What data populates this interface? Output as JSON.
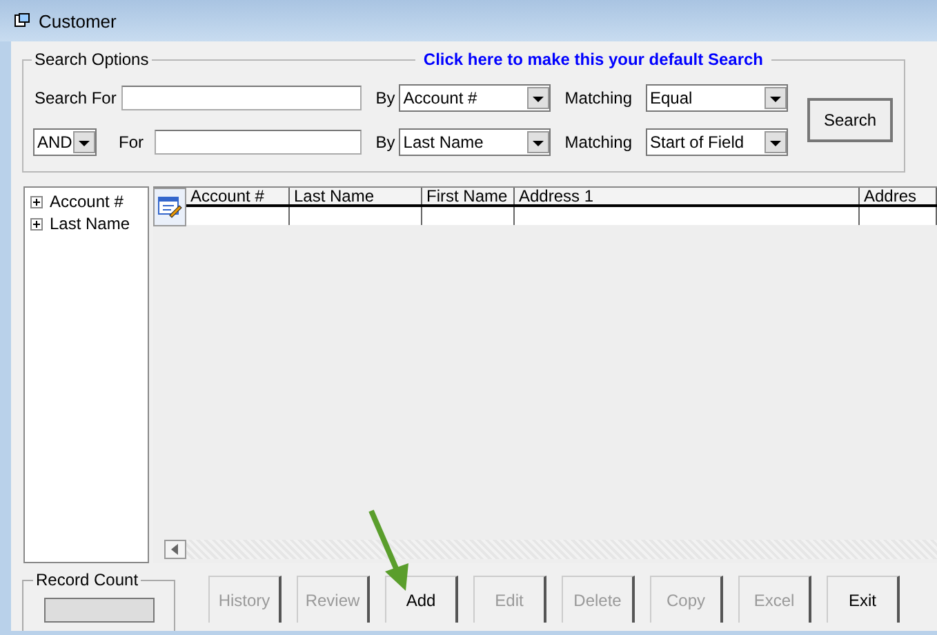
{
  "window": {
    "title": "Customer"
  },
  "search_options": {
    "legend": "Search Options",
    "default_link": "Click here to make this your default Search",
    "rows": [
      {
        "kind": "first",
        "label": "Search For",
        "value": "",
        "by_label": "By",
        "by": "Account #",
        "matching_label": "Matching",
        "matching": "Equal"
      },
      {
        "kind": "joined",
        "operator": "AND",
        "label": "For",
        "value": "",
        "by_label": "By",
        "by": "Last Name",
        "matching_label": "Matching",
        "matching": "Start of Field"
      }
    ],
    "search_button": "Search"
  },
  "tree": [
    {
      "label": "Account #",
      "expanded": false
    },
    {
      "label": "Last Name",
      "expanded": false
    }
  ],
  "table": {
    "columns": [
      "Account #",
      "Last Name",
      "First Name",
      "Address 1",
      "Addres"
    ]
  },
  "record_count": {
    "legend": "Record Count"
  },
  "buttons": [
    {
      "label": "History",
      "disabled": true
    },
    {
      "label": "Review",
      "disabled": true
    },
    {
      "label": "Add",
      "disabled": false
    },
    {
      "label": "Edit",
      "disabled": true
    },
    {
      "label": "Delete",
      "disabled": true
    },
    {
      "label": "Copy",
      "disabled": true
    },
    {
      "label": "Excel",
      "disabled": true
    },
    {
      "label": "Exit",
      "disabled": false
    }
  ]
}
